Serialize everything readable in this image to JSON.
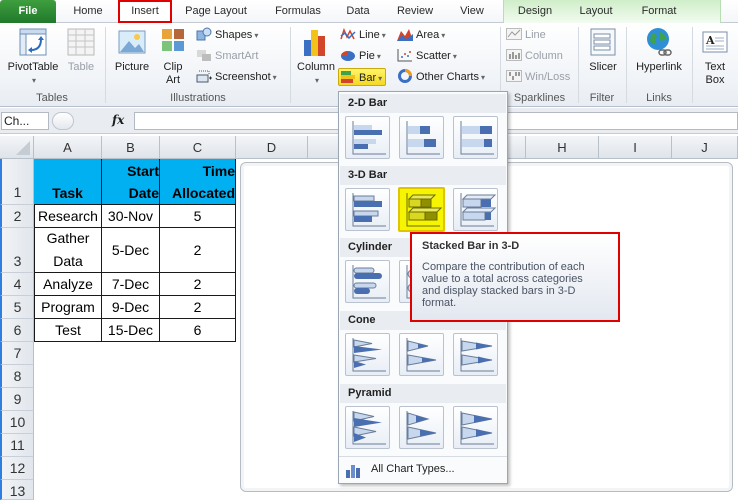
{
  "tabs": [
    {
      "label": "File",
      "active": false
    },
    {
      "label": "Home",
      "active": false
    },
    {
      "label": "Insert",
      "active": true,
      "highlighted": true
    },
    {
      "label": "Page Layout",
      "active": false
    },
    {
      "label": "Formulas",
      "active": false
    },
    {
      "label": "Data",
      "active": false
    },
    {
      "label": "Review",
      "active": false
    },
    {
      "label": "View",
      "active": false
    },
    {
      "label": "Design",
      "active": false,
      "contextual": true
    },
    {
      "label": "Layout",
      "active": false,
      "contextual": true
    },
    {
      "label": "Format",
      "active": false,
      "contextual": true
    }
  ],
  "ribbon": {
    "groups": {
      "tables": "Tables",
      "illustrations": "Illustrations",
      "sparklines": "Sparklines",
      "filter": "Filter",
      "links": "Links"
    },
    "pivottable": "PivotTable",
    "table": "Table",
    "picture": "Picture",
    "clip_art_1": "Clip",
    "clip_art_2": "Art",
    "shapes": "Shapes",
    "smartart": "SmartArt",
    "screenshot": "Screenshot",
    "column": "Column",
    "line": "Line",
    "pie": "Pie",
    "bar": "Bar",
    "area": "Area",
    "scatter": "Scatter",
    "other_charts": "Other Charts",
    "spark_line": "Line",
    "spark_column": "Column",
    "spark_winloss": "Win/Loss",
    "slicer": "Slicer",
    "hyperlink": "Hyperlink",
    "textbox_1": "Text",
    "textbox_2": "Box",
    "dropdown_glyph": "▾"
  },
  "formula_bar": {
    "name_box": "Ch...",
    "fx": "fx",
    "value": ""
  },
  "columns": [
    "A",
    "B",
    "C",
    "D",
    "H",
    "I",
    "J"
  ],
  "rows": [
    "1",
    "2",
    "3",
    "4",
    "5",
    "6",
    "7",
    "8",
    "9",
    "10",
    "11",
    "12",
    "13"
  ],
  "table": {
    "headers": [
      {
        "line1": "",
        "line2": "Task"
      },
      {
        "line1": "Start",
        "line2": "Date"
      },
      {
        "line1": "Time",
        "line2": "Allocated"
      }
    ],
    "rows": [
      {
        "task": "Research",
        "task2": "",
        "start": "30-Nov",
        "time": "5"
      },
      {
        "task": "Gather",
        "task2": "Data",
        "start": "5-Dec",
        "time": "2"
      },
      {
        "task": "Analyze",
        "task2": "",
        "start": "7-Dec",
        "time": "2"
      },
      {
        "task": "Program",
        "task2": "",
        "start": "9-Dec",
        "time": "2"
      },
      {
        "task": "Test",
        "task2": "",
        "start": "15-Dec",
        "time": "6"
      }
    ],
    "header_color": "#00b0f0"
  },
  "bar_menu": {
    "sections": [
      "2-D Bar",
      "3-D Bar",
      "Cylinder",
      "Cone",
      "Pyramid"
    ],
    "items": {
      "bar2d": [
        "Clustered Bar",
        "Stacked Bar",
        "100% Stacked Bar"
      ],
      "bar3d": [
        "Clustered Bar in 3-D",
        "Stacked Bar in 3-D",
        "100% Stacked Bar in 3-D"
      ],
      "cylinder": [
        "Clustered Horizontal Cylinder",
        "Stacked Horizontal Cylinder",
        "100% Stacked Horizontal Cylinder"
      ],
      "cone": [
        "Clustered Horizontal Cone",
        "Stacked Horizontal Cone",
        "100% Stacked Horizontal Cone"
      ],
      "pyramid": [
        "Clustered Horizontal Pyramid",
        "Stacked Horizontal Pyramid",
        "100% Stacked Horizontal Pyramid"
      ]
    },
    "selected": "Stacked Bar in 3-D",
    "all_chart_types": "All Chart Types..."
  },
  "tooltip": {
    "title": "Stacked Bar in 3-D",
    "body_lines": [
      "Compare the contribution of each",
      "value to a total across categories",
      "and display stacked bars in 3-D",
      "format."
    ]
  },
  "colors": {
    "highlight_border": "#e00000",
    "selected_item": "#f6f400",
    "file_tab": "#2a8a35"
  }
}
